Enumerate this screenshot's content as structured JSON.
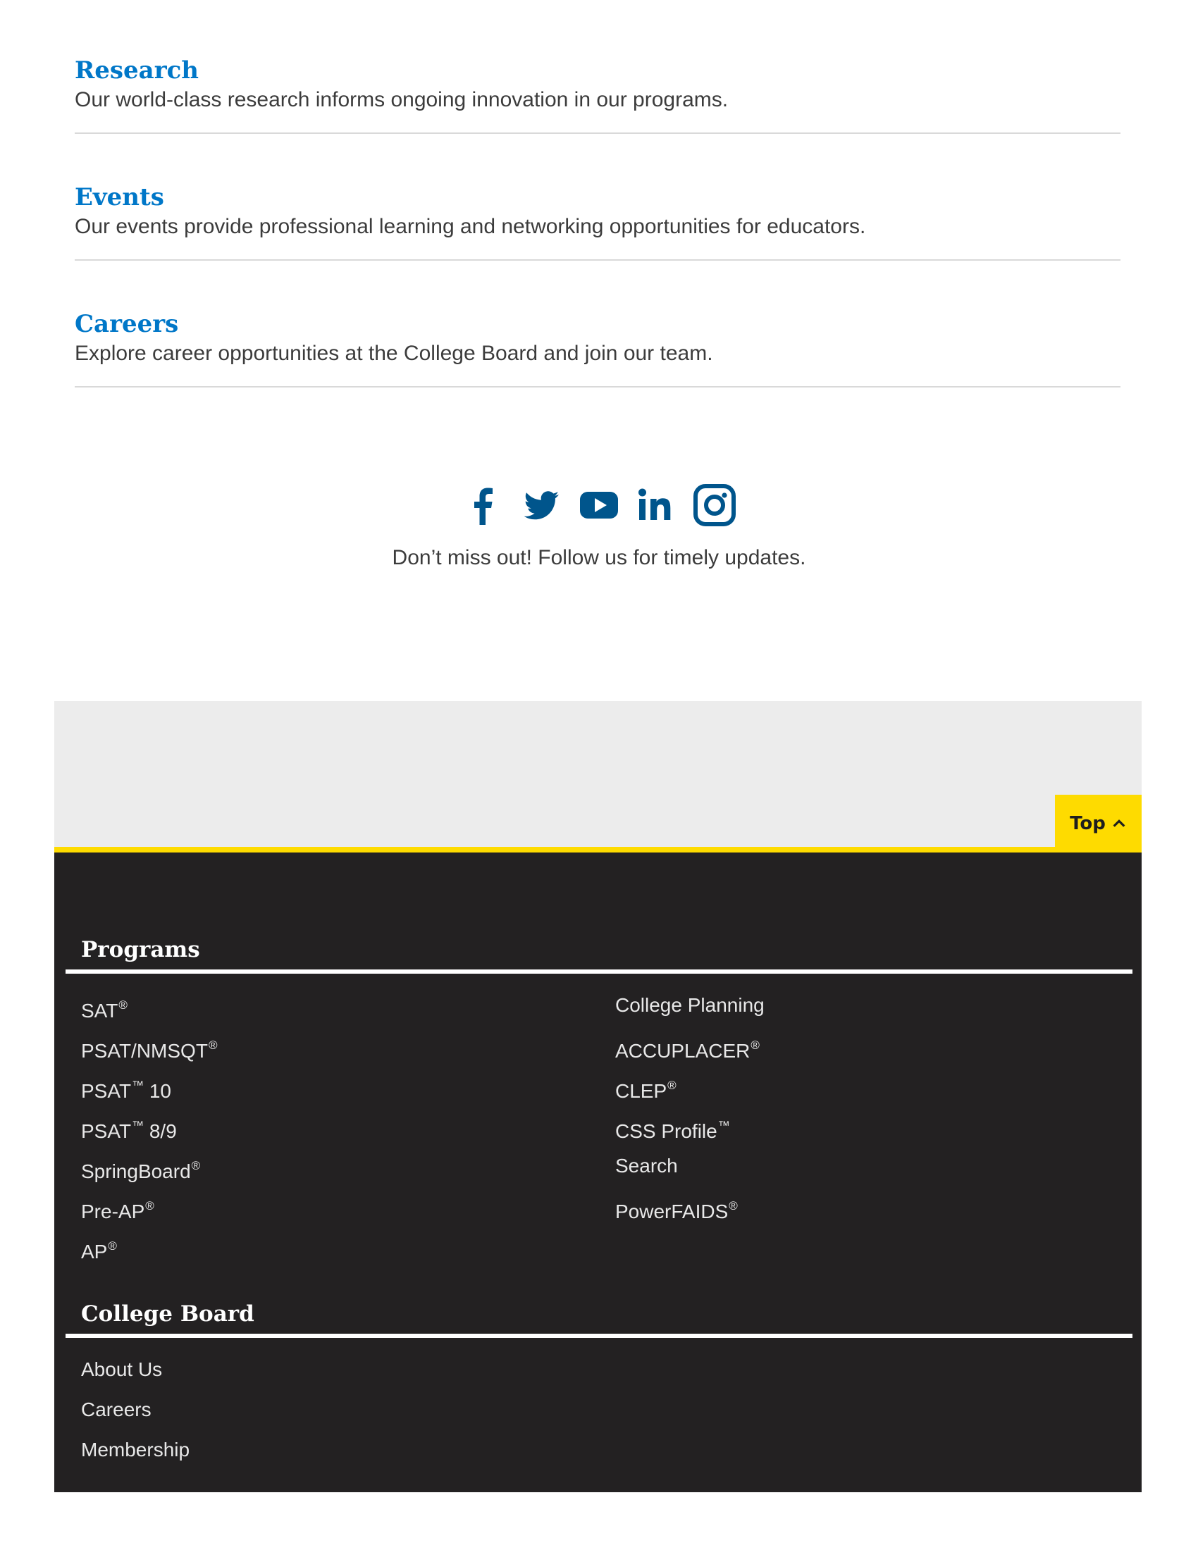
{
  "features": [
    {
      "title": "Research",
      "description": "Our world-class research informs ongoing innovation in our programs."
    },
    {
      "title": "Events",
      "description": "Our events provide professional learning and networking opportunities for educators."
    },
    {
      "title": "Careers",
      "description": "Explore career opportunities at the College Board and join our team."
    }
  ],
  "social": {
    "icons": [
      "facebook-icon",
      "twitter-icon",
      "youtube-icon",
      "linkedin-icon",
      "instagram-icon"
    ],
    "tagline": "Don’t miss out! Follow us for timely updates.",
    "icon_color": "#00558c"
  },
  "top_button": {
    "label": "Top"
  },
  "footer": {
    "programs": {
      "heading": "Programs",
      "col1": [
        {
          "name": "SAT",
          "mark": "®"
        },
        {
          "name": "PSAT/NMSQT",
          "mark": "®"
        },
        {
          "name": "PSAT",
          "mark": "™",
          "suffix": " 10"
        },
        {
          "name": "PSAT",
          "mark": "™",
          "suffix": " 8/9"
        },
        {
          "name": "SpringBoard",
          "mark": "®"
        },
        {
          "name": "Pre-AP",
          "mark": "®"
        },
        {
          "name": "AP",
          "mark": "®"
        }
      ],
      "col2": [
        {
          "name": "College Planning",
          "mark": ""
        },
        {
          "name": "ACCUPLACER",
          "mark": "®"
        },
        {
          "name": "CLEP",
          "mark": "®"
        },
        {
          "name": "CSS Profile",
          "mark": "™"
        },
        {
          "name": "Search",
          "mark": ""
        },
        {
          "name": "PowerFAIDS",
          "mark": "®"
        }
      ]
    },
    "college_board": {
      "heading": "College Board",
      "links": [
        "About Us",
        "Careers",
        "Membership"
      ]
    }
  },
  "colors": {
    "accent": "#0077c8",
    "highlight": "#fedb00",
    "footer_bg": "#232122"
  }
}
